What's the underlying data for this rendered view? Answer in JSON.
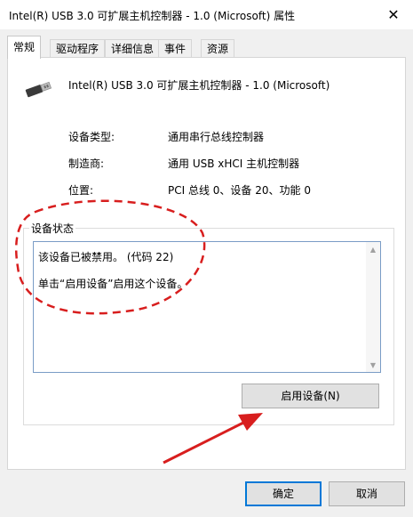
{
  "window": {
    "title": "Intel(R) USB 3.0 可扩展主机控制器 - 1.0 (Microsoft) 属性"
  },
  "tabs": [
    {
      "label": "常规",
      "active": true
    },
    {
      "label": "驱动程序",
      "active": false
    },
    {
      "label": "详细信息",
      "active": false
    },
    {
      "label": "事件",
      "active": false
    },
    {
      "label": "资源",
      "active": false
    }
  ],
  "device": {
    "name": "Intel(R) USB 3.0 可扩展主机控制器 - 1.0 (Microsoft)",
    "icon": "usb-connector-icon"
  },
  "properties": {
    "type_label": "设备类型:",
    "type_value": "通用串行总线控制器",
    "manufacturer_label": "制造商:",
    "manufacturer_value": "通用 USB xHCI 主机控制器",
    "location_label": "位置:",
    "location_value": "PCI 总线 0、设备 20、功能 0"
  },
  "status": {
    "group_label": "设备状态",
    "line1": "该设备已被禁用。 (代码 22)",
    "line2": "单击“启用设备”启用这个设备。"
  },
  "buttons": {
    "enable": "启用设备(N)",
    "ok": "确定",
    "cancel": "取消"
  },
  "annotation": {
    "color": "#d81e1e"
  }
}
